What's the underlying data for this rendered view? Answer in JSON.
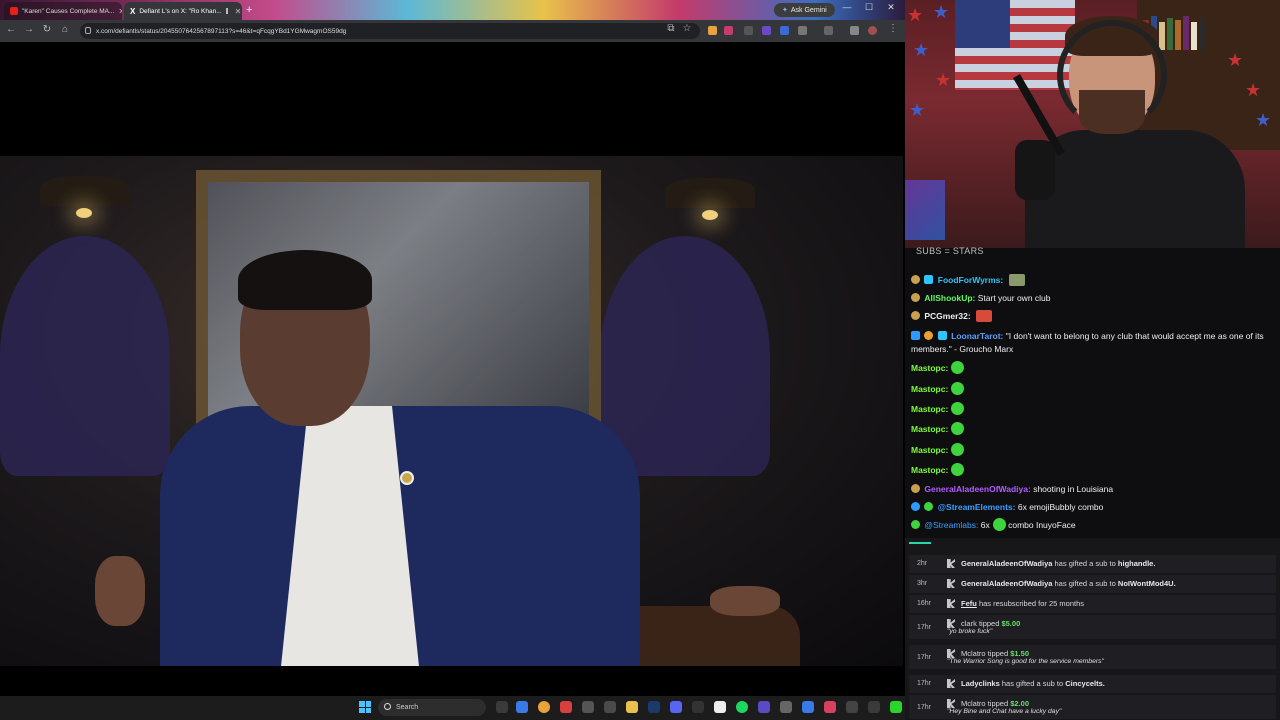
{
  "browser": {
    "tabs": [
      {
        "label": "\"Karen\" Causes Complete MA..."
      },
      {
        "label": "Defiant L's on X: \"Ro Khan..."
      }
    ],
    "ask_gemini": "Ask Gemini",
    "url": "x.com/defiantls/status/2045507642567897113?s=46&t=qFcqgYBd1YGMwagmOS59dg"
  },
  "taskbar": {
    "search_placeholder": "Search"
  },
  "chat": {
    "title": "SUBS = STARS",
    "messages": [
      {
        "user": "FoodForWyrms:",
        "text": "",
        "color": "#2ec4ff"
      },
      {
        "user": "AllShookUp:",
        "text": "Start your own club",
        "color": "#5cff5c"
      },
      {
        "user": "PCGmer32:",
        "text": "",
        "color": "#efeff1"
      },
      {
        "user": "LoonarTarot:",
        "text": "\"I don't want to belong to any club that would accept me as one of its members.\" - Groucho Marx",
        "color": "#5ca0ff"
      },
      {
        "user": "Mastopc:",
        "text": "",
        "color": "#7cff3c"
      },
      {
        "user": "Mastopc:",
        "text": "",
        "color": "#7cff3c"
      },
      {
        "user": "Mastopc:",
        "text": "",
        "color": "#7cff3c"
      },
      {
        "user": "Mastopc:",
        "text": "",
        "color": "#7cff3c"
      },
      {
        "user": "Mastopc:",
        "text": "",
        "color": "#7cff3c"
      },
      {
        "user": "Mastopc:",
        "text": "",
        "color": "#7cff3c"
      },
      {
        "user": "GeneralAladeenOfWadiya:",
        "text": "shooting in Louisiana",
        "color": "#b35cff"
      },
      {
        "user": "@StreamElements:",
        "text": "6x emojiBubbly combo",
        "color": "#3aa0ff"
      },
      {
        "user": "@Streamlabs:",
        "text": "6x",
        "text2": "combo InuyoFace",
        "color": "#3aa0ff"
      }
    ]
  },
  "events": [
    {
      "time": "2hr",
      "name": "GeneralAladeenOfWadiya",
      "action": "has gifted a sub to",
      "target": "highandle."
    },
    {
      "time": "3hr",
      "name": "GeneralAladeenOfWadiya",
      "action": "has gifted a sub to",
      "target": "NoIWontMod4U."
    },
    {
      "time": "16hr",
      "name": "Fefu",
      "action": "has resubscribed for 25 months",
      "target": ""
    },
    {
      "time": "17hr",
      "name": "clark",
      "action": "tipped",
      "amount": "$5.00",
      "message": "\"yo broke fuck\""
    },
    {
      "time": "17hr",
      "name": "Mclatro",
      "action": "tipped",
      "amount": "$1.50",
      "message": "\"The Warrior Song is good for the service members\""
    },
    {
      "time": "17hr",
      "name": "Ladyclinks",
      "action": "has gifted a sub to",
      "target": "Cincycelts."
    },
    {
      "time": "17hr",
      "name": "Mclatro",
      "action": "tipped",
      "amount": "$2.00",
      "message": "\"Hey Bine and Chat have a lucky day\""
    }
  ]
}
